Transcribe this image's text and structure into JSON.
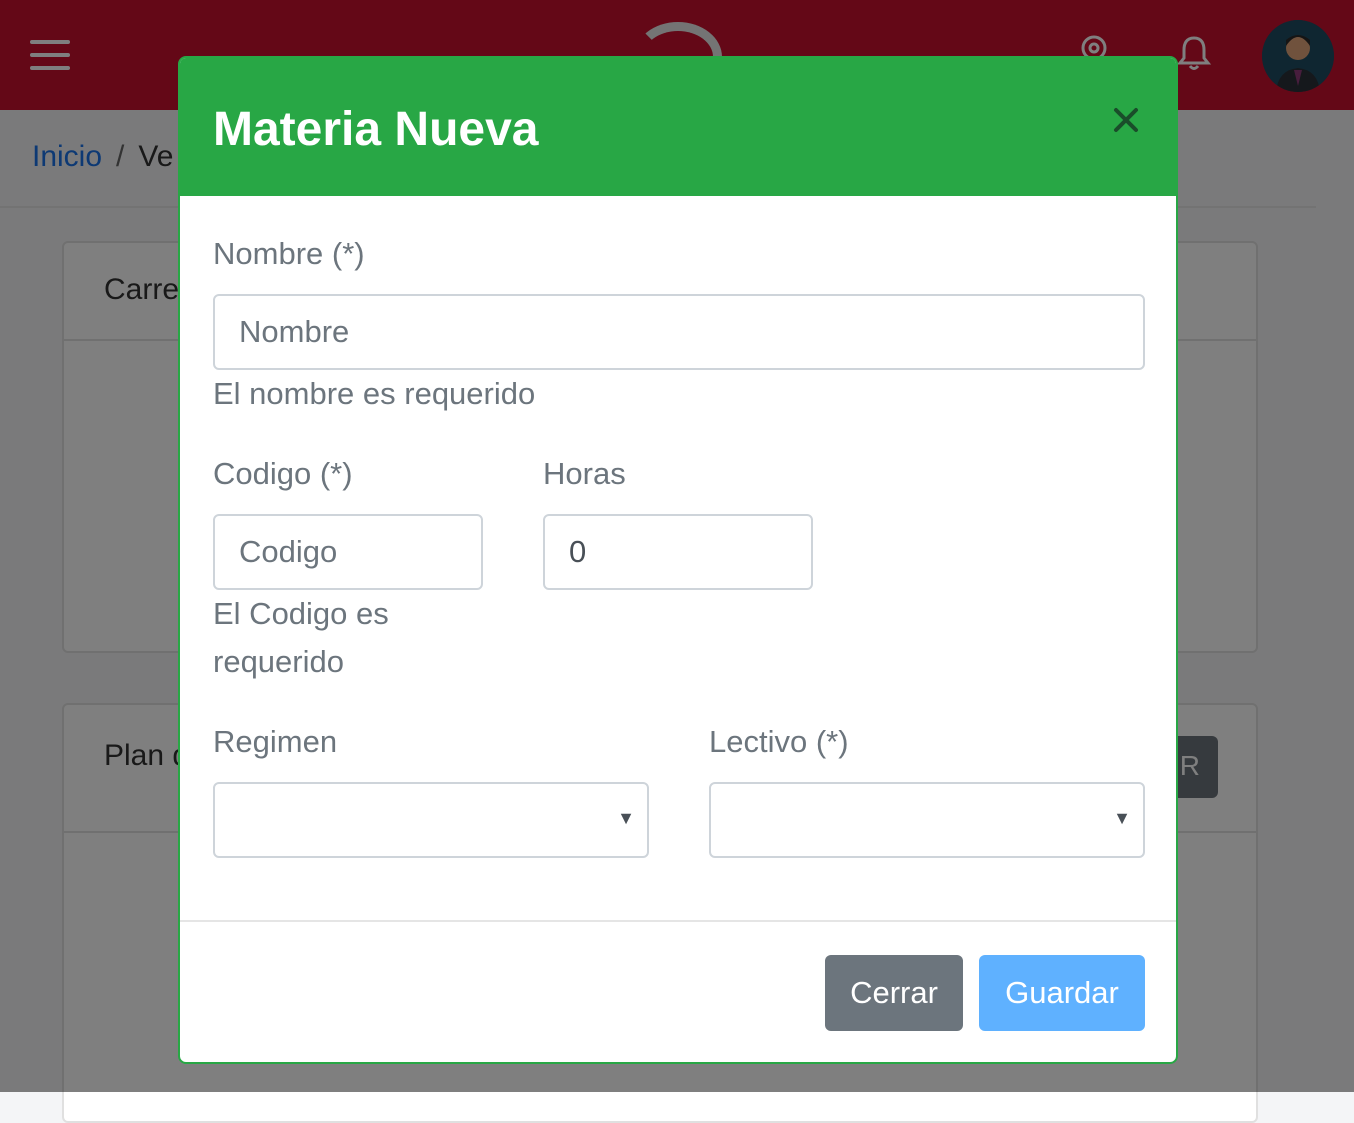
{
  "breadcrumb": {
    "home": "Inicio",
    "separator": "/",
    "current": "Ve"
  },
  "cards": [
    {
      "title": "Carre"
    },
    {
      "title": "Plan d",
      "button_label": "IR"
    }
  ],
  "modal": {
    "title": "Materia Nueva",
    "close_icon": "close-icon",
    "fields": {
      "nombre": {
        "label": "Nombre (*)",
        "placeholder": "Nombre",
        "value": "",
        "error": "El nombre es requerido"
      },
      "codigo": {
        "label": "Codigo (*)",
        "placeholder": "Codigo",
        "value": "",
        "error_line1": "El Codigo es",
        "error_line2": "requerido"
      },
      "horas": {
        "label": "Horas",
        "value": "0"
      },
      "regimen": {
        "label": "Regimen",
        "selected": ""
      },
      "lectivo": {
        "label": "Lectivo (*)",
        "selected": ""
      }
    },
    "buttons": {
      "cerrar": "Cerrar",
      "guardar": "Guardar"
    }
  },
  "colors": {
    "topbar": "#c8102e",
    "modal_header": "#28a745",
    "button_secondary": "#6c757d",
    "button_primary": "#5fb1ff"
  },
  "icons": [
    "menu-icon",
    "location-icon",
    "bell-icon",
    "user-avatar",
    "caret-down-icon"
  ]
}
